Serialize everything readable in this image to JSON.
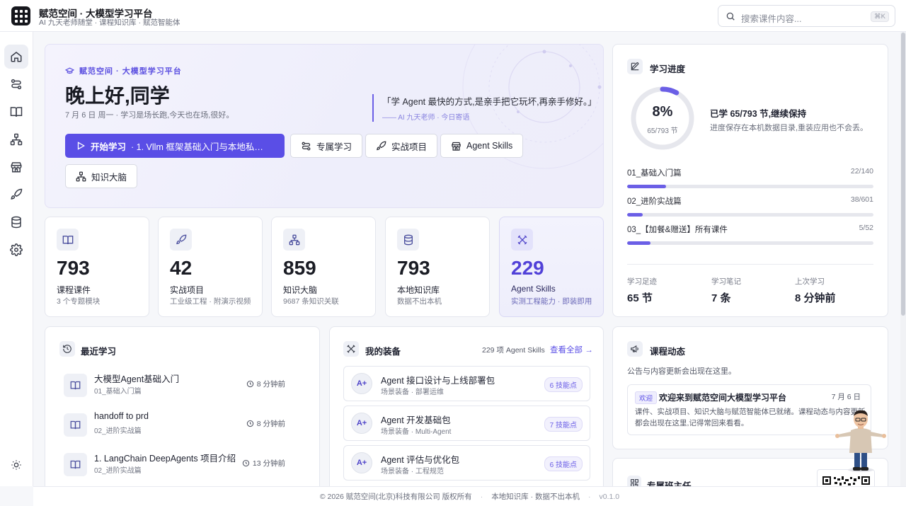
{
  "header": {
    "title": "赋范空间 · 大模型学习平台",
    "subtitle": "AI 九天老师随堂 · 课程知识库 · 赋范智能体",
    "search_placeholder": "搜索课件内容...",
    "search_shortcut": "⌘K"
  },
  "sidebar": {
    "items": [
      {
        "icon": "home-icon",
        "active": true
      },
      {
        "icon": "route-icon"
      },
      {
        "icon": "book-icon"
      },
      {
        "icon": "network-icon"
      },
      {
        "icon": "store-icon"
      },
      {
        "icon": "rocket-icon"
      },
      {
        "icon": "database-icon"
      },
      {
        "icon": "gear-icon"
      }
    ],
    "bottom_icon": "sun-icon"
  },
  "hero": {
    "tag": "赋范空间 · 大模型学习平台",
    "greeting": "晚上好,同学",
    "date_line": "7 月 6 日 周一 · 学习是场长跑,今天也在场,很好。",
    "quote": "「学 Agent 最快的方式,是亲手把它玩坏,再亲手修好。」",
    "quote_author": "—— AI 九天老师 · 今日寄语",
    "start_button": "开始学习",
    "start_course": "· 1. Vllm 框架基础入门与本地私有化...",
    "buttons": [
      "专属学习",
      "实战项目",
      "Agent Skills",
      "知识大脑"
    ]
  },
  "stats": [
    {
      "value": "793",
      "label": "课程课件",
      "sub": "3 个专题模块",
      "icon": "book-icon"
    },
    {
      "value": "42",
      "label": "实战项目",
      "sub": "工业级工程 · 附演示视频",
      "icon": "rocket-icon"
    },
    {
      "value": "859",
      "label": "知识大脑",
      "sub": "9687 条知识关联",
      "icon": "network-icon"
    },
    {
      "value": "793",
      "label": "本地知识库",
      "sub": "数据不出本机",
      "icon": "database-icon"
    },
    {
      "value": "229",
      "label": "Agent Skills",
      "sub": "实测工程能力 · 即装即用",
      "icon": "tools-icon",
      "highlight": true
    }
  ],
  "progress": {
    "title": "学习进度",
    "percent": "8%",
    "percent_value": 0.08,
    "count": "65/793 节",
    "headline": "已学 65/793 节,继续保持",
    "desc": "进度保存在本机数据目录,重装应用也不会丢。",
    "modules": [
      {
        "name": "01_基础入门篇",
        "done": 22,
        "total": 140,
        "ratio": "22/140"
      },
      {
        "name": "02_进阶实战篇",
        "done": 38,
        "total": 601,
        "ratio": "38/601"
      },
      {
        "name": "03_【加餐&赠送】所有课件",
        "done": 5,
        "total": 52,
        "ratio": "5/52"
      }
    ],
    "summary": [
      {
        "label": "学习足迹",
        "value": "65 节"
      },
      {
        "label": "学习笔记",
        "value": "7 条"
      },
      {
        "label": "上次学习",
        "value": "8 分钟前"
      }
    ]
  },
  "recent": {
    "title": "最近学习",
    "items": [
      {
        "title": "大模型Agent基础入门",
        "module": "01_基础入门篇",
        "time": "8 分钟前"
      },
      {
        "title": "handoff to prd",
        "module": "02_进阶实战篇",
        "time": "8 分钟前"
      },
      {
        "title": "1. LangChain DeepAgents 项目介绍",
        "module": "02_进阶实战篇",
        "time": "13 分钟前"
      }
    ]
  },
  "gear": {
    "title": "我的装备",
    "count": "229 项 Agent Skills",
    "view_all": "查看全部 →",
    "items": [
      {
        "badge": "A+",
        "title": "Agent 接口设计与上线部署包",
        "sub": "场景装备 · 部署运维",
        "points": "6 技能点"
      },
      {
        "badge": "A+",
        "title": "Agent 开发基础包",
        "sub": "场景装备 · Multi-Agent",
        "points": "7 技能点"
      },
      {
        "badge": "A+",
        "title": "Agent 评估与优化包",
        "sub": "场景装备 · 工程规范",
        "points": "6 技能点"
      }
    ]
  },
  "news": {
    "title": "课程动态",
    "desc": "公告与内容更新会出现在这里。",
    "item": {
      "tag": "欢迎",
      "title": "欢迎来到赋范空间大模型学习平台",
      "date": "7 月 6 日",
      "body": "课件、实战项目、知识大脑与赋范智能体已就绪。课程动态与内容更新都会出现在这里,记得常回来看看。"
    }
  },
  "coach": {
    "title": "专属班主任"
  },
  "footer": {
    "copyright": "© 2026 赋范空间(北京)科技有限公司 版权所有",
    "note": "本地知识库 · 数据不出本机",
    "version": "v0.1.0"
  },
  "colors": {
    "accent": "#5a4ee6",
    "accent_dark": "#5141d8",
    "progress": "#6b5fe6"
  }
}
